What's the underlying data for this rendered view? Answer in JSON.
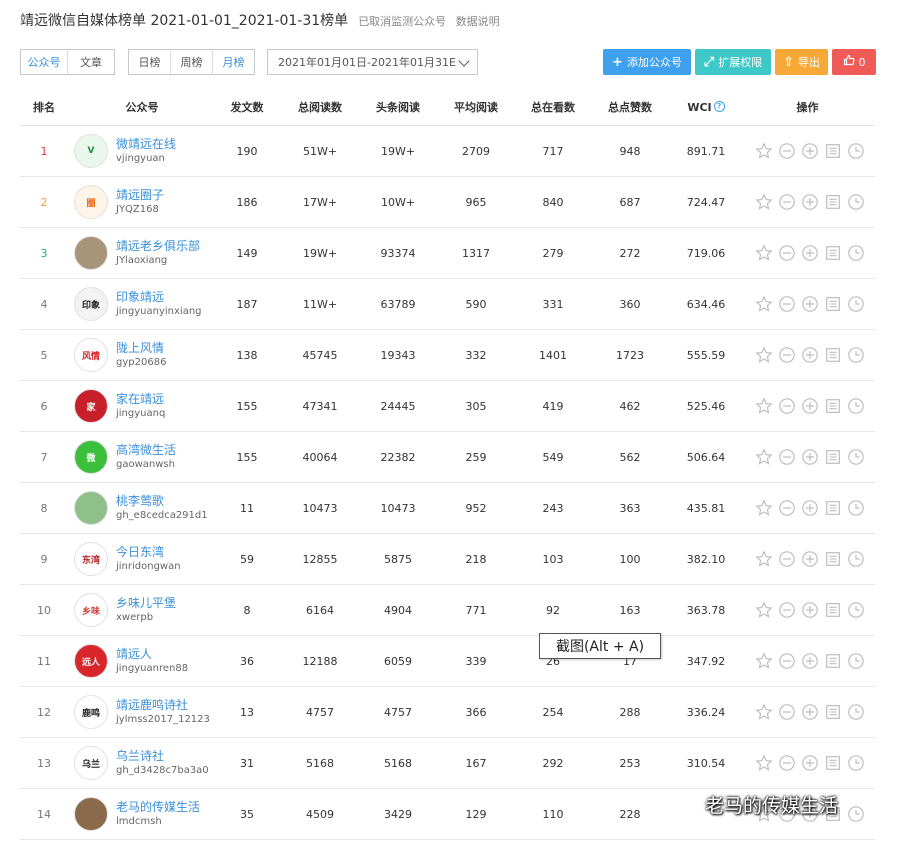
{
  "header": {
    "title": "靖远微信自媒体榜单 2021-01-01_2021-01-31榜单",
    "links": [
      "已取消监测公众号",
      "数据说明"
    ]
  },
  "toolbar": {
    "type_tabs": [
      {
        "label": "公众号",
        "active": true
      },
      {
        "label": "文章",
        "active": false
      }
    ],
    "period_tabs": [
      {
        "label": "日榜",
        "active": false
      },
      {
        "label": "周榜",
        "active": false
      },
      {
        "label": "月榜",
        "active": true
      }
    ],
    "date_range": "2021年01月01日-2021年01月31E",
    "buttons": {
      "add": "添加公众号",
      "expand": "扩展权限",
      "export": "导出",
      "like_count": "0"
    }
  },
  "colors": {
    "accent": "#3a8fd9",
    "add": "#3fa1ee",
    "expand": "#3ec8c8",
    "export": "#f7a937",
    "like": "#f05a57",
    "rank1": "#e0323c",
    "rank2": "#f0a030",
    "rank3": "#2faa74"
  },
  "table": {
    "columns": [
      "排名",
      "公众号",
      "发文数",
      "总阅读数",
      "头条阅读",
      "平均阅读",
      "总在看数",
      "总点赞数",
      "WCI",
      "操作"
    ],
    "wci_help": "?",
    "ops_icons": [
      "star-icon",
      "minus-circle-icon",
      "plus-circle-icon",
      "list-icon",
      "clock-icon"
    ],
    "rows": [
      {
        "rank": "1",
        "name": "微靖远在线",
        "id": "vjingyuan",
        "posts": "190",
        "total_reads": "51W+",
        "headline_reads": "19W+",
        "avg_reads": "2709",
        "looking": "717",
        "likes": "948",
        "wci": "891.71",
        "avatar_text": "V",
        "avatar_color": "#1e8e3e",
        "avatar_bg": "#e9f7ec"
      },
      {
        "rank": "2",
        "name": "靖远圈子",
        "id": "JYQZ168",
        "posts": "186",
        "total_reads": "17W+",
        "headline_reads": "10W+",
        "avg_reads": "965",
        "looking": "840",
        "likes": "687",
        "wci": "724.47",
        "avatar_text": "圈",
        "avatar_color": "#e86a1c",
        "avatar_bg": "#fff4e8"
      },
      {
        "rank": "3",
        "name": "靖远老乡俱乐部",
        "id": "JYlaoxiang",
        "posts": "149",
        "total_reads": "19W+",
        "headline_reads": "93374",
        "avg_reads": "1317",
        "looking": "279",
        "likes": "272",
        "wci": "719.06",
        "avatar_text": "",
        "avatar_color": "#6d5a44",
        "avatar_bg": "#a89478"
      },
      {
        "rank": "4",
        "name": "印象靖远",
        "id": "jingyuanyinxiang",
        "posts": "187",
        "total_reads": "11W+",
        "headline_reads": "63789",
        "avg_reads": "590",
        "looking": "331",
        "likes": "360",
        "wci": "634.46",
        "avatar_text": "印象",
        "avatar_color": "#222",
        "avatar_bg": "#f3f3f3"
      },
      {
        "rank": "5",
        "name": "陇上风情",
        "id": "gyp20686",
        "posts": "138",
        "total_reads": "45745",
        "headline_reads": "19343",
        "avg_reads": "332",
        "looking": "1401",
        "likes": "1723",
        "wci": "555.59",
        "avatar_text": "风情",
        "avatar_color": "#d61f26",
        "avatar_bg": "#fff"
      },
      {
        "rank": "6",
        "name": "家在靖远",
        "id": "jingyuanq",
        "posts": "155",
        "total_reads": "47341",
        "headline_reads": "24445",
        "avg_reads": "305",
        "looking": "419",
        "likes": "462",
        "wci": "525.46",
        "avatar_text": "家",
        "avatar_color": "#fff",
        "avatar_bg": "#c8202a"
      },
      {
        "rank": "7",
        "name": "高湾微生活",
        "id": "gaowanwsh",
        "posts": "155",
        "total_reads": "40064",
        "headline_reads": "22382",
        "avg_reads": "259",
        "looking": "549",
        "likes": "562",
        "wci": "506.64",
        "avatar_text": "微",
        "avatar_color": "#fff",
        "avatar_bg": "#3cc03c"
      },
      {
        "rank": "8",
        "name": "桃李莺歌",
        "id": "gh_e8cedca291d1",
        "posts": "11",
        "total_reads": "10473",
        "headline_reads": "10473",
        "avg_reads": "952",
        "looking": "243",
        "likes": "363",
        "wci": "435.81",
        "avatar_text": "",
        "avatar_color": "#3c7a4a",
        "avatar_bg": "#8fbf8a"
      },
      {
        "rank": "9",
        "name": "今日东湾",
        "id": "jinridongwan",
        "posts": "59",
        "total_reads": "12855",
        "headline_reads": "5875",
        "avg_reads": "218",
        "looking": "103",
        "likes": "100",
        "wci": "382.10",
        "avatar_text": "东湾",
        "avatar_color": "#b3262b",
        "avatar_bg": "#fff"
      },
      {
        "rank": "10",
        "name": "乡味儿平堡",
        "id": "xwerpb",
        "posts": "8",
        "total_reads": "6164",
        "headline_reads": "4904",
        "avg_reads": "771",
        "looking": "92",
        "likes": "163",
        "wci": "363.78",
        "avatar_text": "乡味",
        "avatar_color": "#d63b3b",
        "avatar_bg": "#fff"
      },
      {
        "rank": "11",
        "name": "靖远人",
        "id": "jingyuanren88",
        "posts": "36",
        "total_reads": "12188",
        "headline_reads": "6059",
        "avg_reads": "339",
        "looking": "26",
        "likes": "17",
        "wci": "347.92",
        "avatar_text": "远人",
        "avatar_color": "#fff",
        "avatar_bg": "#d8262d"
      },
      {
        "rank": "12",
        "name": "靖远鹿鸣诗社",
        "id": "jylmss2017_12123",
        "posts": "13",
        "total_reads": "4757",
        "headline_reads": "4757",
        "avg_reads": "366",
        "looking": "254",
        "likes": "288",
        "wci": "336.24",
        "avatar_text": "鹿鸣",
        "avatar_color": "#222",
        "avatar_bg": "#fff"
      },
      {
        "rank": "13",
        "name": "乌兰诗社",
        "id": "gh_d3428c7ba3a0",
        "posts": "31",
        "total_reads": "5168",
        "headline_reads": "5168",
        "avg_reads": "167",
        "looking": "292",
        "likes": "253",
        "wci": "310.54",
        "avatar_text": "乌兰",
        "avatar_color": "#222",
        "avatar_bg": "#fff"
      },
      {
        "rank": "14",
        "name": "老马的传媒生活",
        "id": "lmdcmsh",
        "posts": "35",
        "total_reads": "4509",
        "headline_reads": "3429",
        "avg_reads": "129",
        "looking": "110",
        "likes": "228",
        "wci": "",
        "avatar_text": "",
        "avatar_color": "#fff",
        "avatar_bg": "#8a6a4a"
      }
    ]
  },
  "tooltip": "截图(Alt + A)",
  "watermark": "老马的传媒生活"
}
